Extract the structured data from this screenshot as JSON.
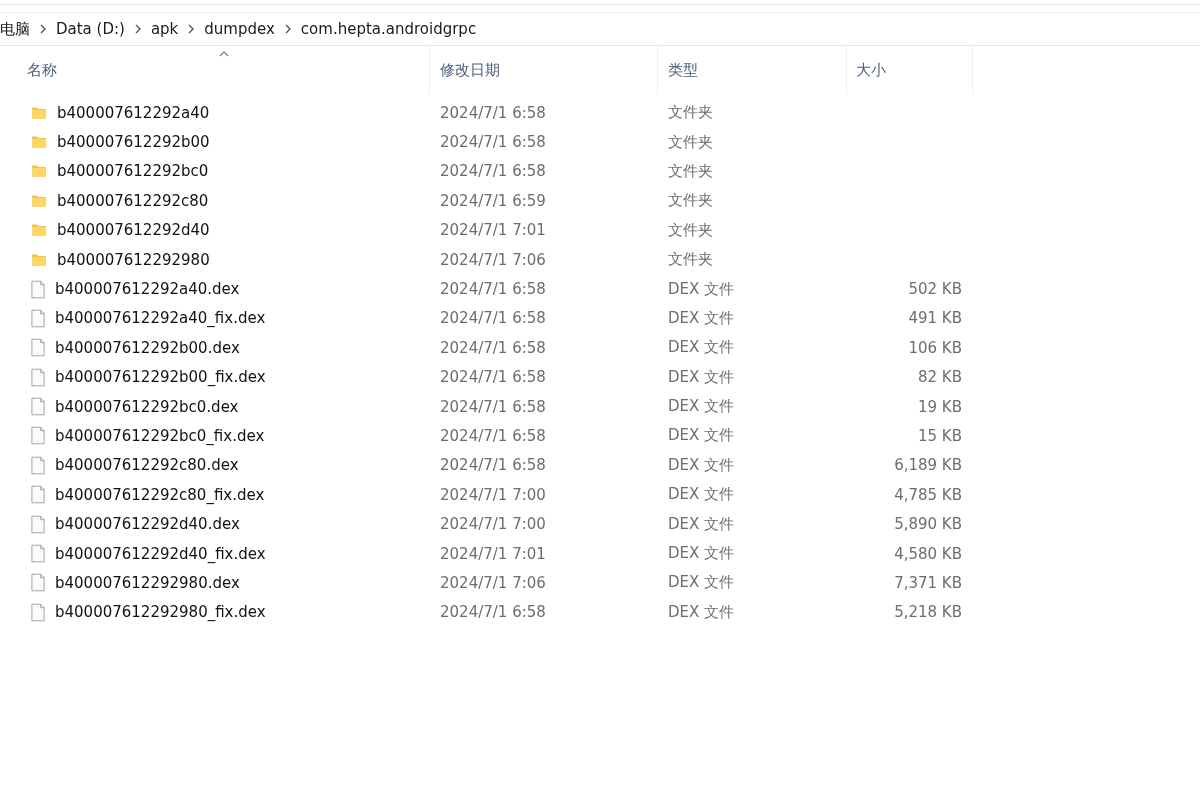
{
  "breadcrumb": [
    "电脑",
    "Data (D:)",
    "apk",
    "dumpdex",
    "com.hepta.androidgrpc"
  ],
  "table": {
    "columns": [
      "名称",
      "修改日期",
      "类型",
      "大小"
    ],
    "rows": [
      {
        "kind": "folder",
        "name": "b400007612292a40",
        "date": "2024/7/1 6:58",
        "type": "文件夹"
      },
      {
        "kind": "folder",
        "name": "b400007612292b00",
        "date": "2024/7/1 6:58",
        "type": "文件夹"
      },
      {
        "kind": "folder",
        "name": "b400007612292bc0",
        "date": "2024/7/1 6:58",
        "type": "文件夹"
      },
      {
        "kind": "folder",
        "name": "b400007612292c80",
        "date": "2024/7/1 6:59",
        "type": "文件夹"
      },
      {
        "kind": "folder",
        "name": "b400007612292d40",
        "date": "2024/7/1 7:01",
        "type": "文件夹"
      },
      {
        "kind": "folder",
        "name": "b400007612292980",
        "date": "2024/7/1 7:06",
        "type": "文件夹"
      },
      {
        "kind": "file",
        "name": "b400007612292a40.dex",
        "date": "2024/7/1 6:58",
        "type": "DEX 文件",
        "size": "502 KB"
      },
      {
        "kind": "file",
        "name": "b400007612292a40_fix.dex",
        "date": "2024/7/1 6:58",
        "type": "DEX 文件",
        "size": "491 KB"
      },
      {
        "kind": "file",
        "name": "b400007612292b00.dex",
        "date": "2024/7/1 6:58",
        "type": "DEX 文件",
        "size": "106 KB"
      },
      {
        "kind": "file",
        "name": "b400007612292b00_fix.dex",
        "date": "2024/7/1 6:58",
        "type": "DEX 文件",
        "size": "82 KB"
      },
      {
        "kind": "file",
        "name": "b400007612292bc0.dex",
        "date": "2024/7/1 6:58",
        "type": "DEX 文件",
        "size": "19 KB"
      },
      {
        "kind": "file",
        "name": "b400007612292bc0_fix.dex",
        "date": "2024/7/1 6:58",
        "type": "DEX 文件",
        "size": "15 KB"
      },
      {
        "kind": "file",
        "name": "b400007612292c80.dex",
        "date": "2024/7/1 6:58",
        "type": "DEX 文件",
        "size": "6,189 KB"
      },
      {
        "kind": "file",
        "name": "b400007612292c80_fix.dex",
        "date": "2024/7/1 7:00",
        "type": "DEX 文件",
        "size": "4,785 KB"
      },
      {
        "kind": "file",
        "name": "b400007612292d40.dex",
        "date": "2024/7/1 7:00",
        "type": "DEX 文件",
        "size": "5,890 KB"
      },
      {
        "kind": "file",
        "name": "b400007612292d40_fix.dex",
        "date": "2024/7/1 7:01",
        "type": "DEX 文件",
        "size": "4,580 KB"
      },
      {
        "kind": "file",
        "name": "b400007612292980.dex",
        "date": "2024/7/1 7:06",
        "type": "DEX 文件",
        "size": "7,371 KB"
      },
      {
        "kind": "file",
        "name": "b400007612292980_fix.dex",
        "date": "2024/7/1 6:58",
        "type": "DEX 文件",
        "size": "5,218 KB"
      }
    ]
  }
}
